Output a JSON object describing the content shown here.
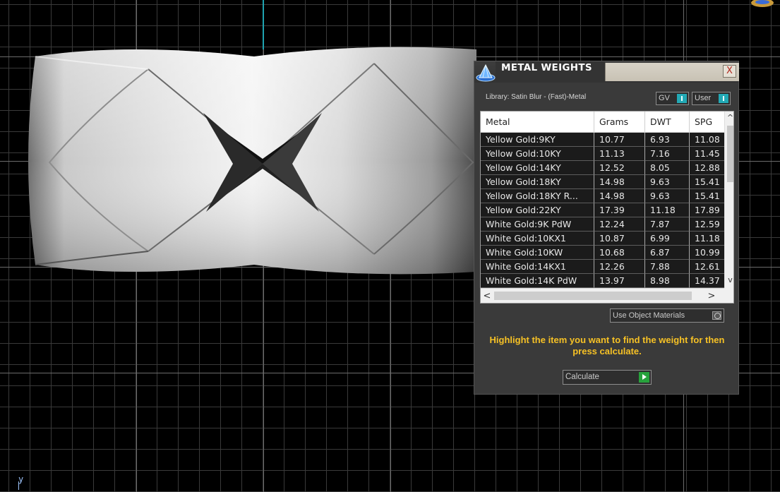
{
  "viewport": {
    "axis_label": "y"
  },
  "panel": {
    "title": "METAL WEIGHTS",
    "close_label": "X",
    "library_label": "Library: Satin Blur - (Fast)-Metal",
    "toggle_gv": "GV",
    "toggle_user": "User",
    "table": {
      "headers": [
        "Metal",
        "Grams",
        "DWT",
        "SPG"
      ],
      "rows": [
        [
          "Yellow Gold:9KY",
          "10.77",
          "6.93",
          "11.08"
        ],
        [
          "Yellow Gold:10KY",
          "11.13",
          "7.16",
          "11.45"
        ],
        [
          "Yellow Gold:14KY",
          "12.52",
          "8.05",
          "12.88"
        ],
        [
          "Yellow Gold:18KY",
          "14.98",
          "9.63",
          "15.41"
        ],
        [
          "Yellow Gold:18KY R...",
          "14.98",
          "9.63",
          "15.41"
        ],
        [
          "Yellow Gold:22KY",
          "17.39",
          "11.18",
          "17.89"
        ],
        [
          "White Gold:9K PdW",
          "12.24",
          "7.87",
          "12.59"
        ],
        [
          "White Gold:10KX1",
          "10.87",
          "6.99",
          "11.18"
        ],
        [
          "White Gold:10KW",
          "10.68",
          "6.87",
          "10.99"
        ],
        [
          "White Gold:14KX1",
          "12.26",
          "7.88",
          "12.61"
        ],
        [
          "White Gold:14K PdW",
          "13.97",
          "8.98",
          "14.37"
        ]
      ],
      "scroll_up": "^",
      "scroll_down": "v",
      "scroll_left": "<",
      "scroll_right": ">"
    },
    "use_object_materials_label": "Use Object Materials",
    "instructions": "Highlight the item you want to find the weight for then press calculate.",
    "calculate_label": "Calculate"
  }
}
